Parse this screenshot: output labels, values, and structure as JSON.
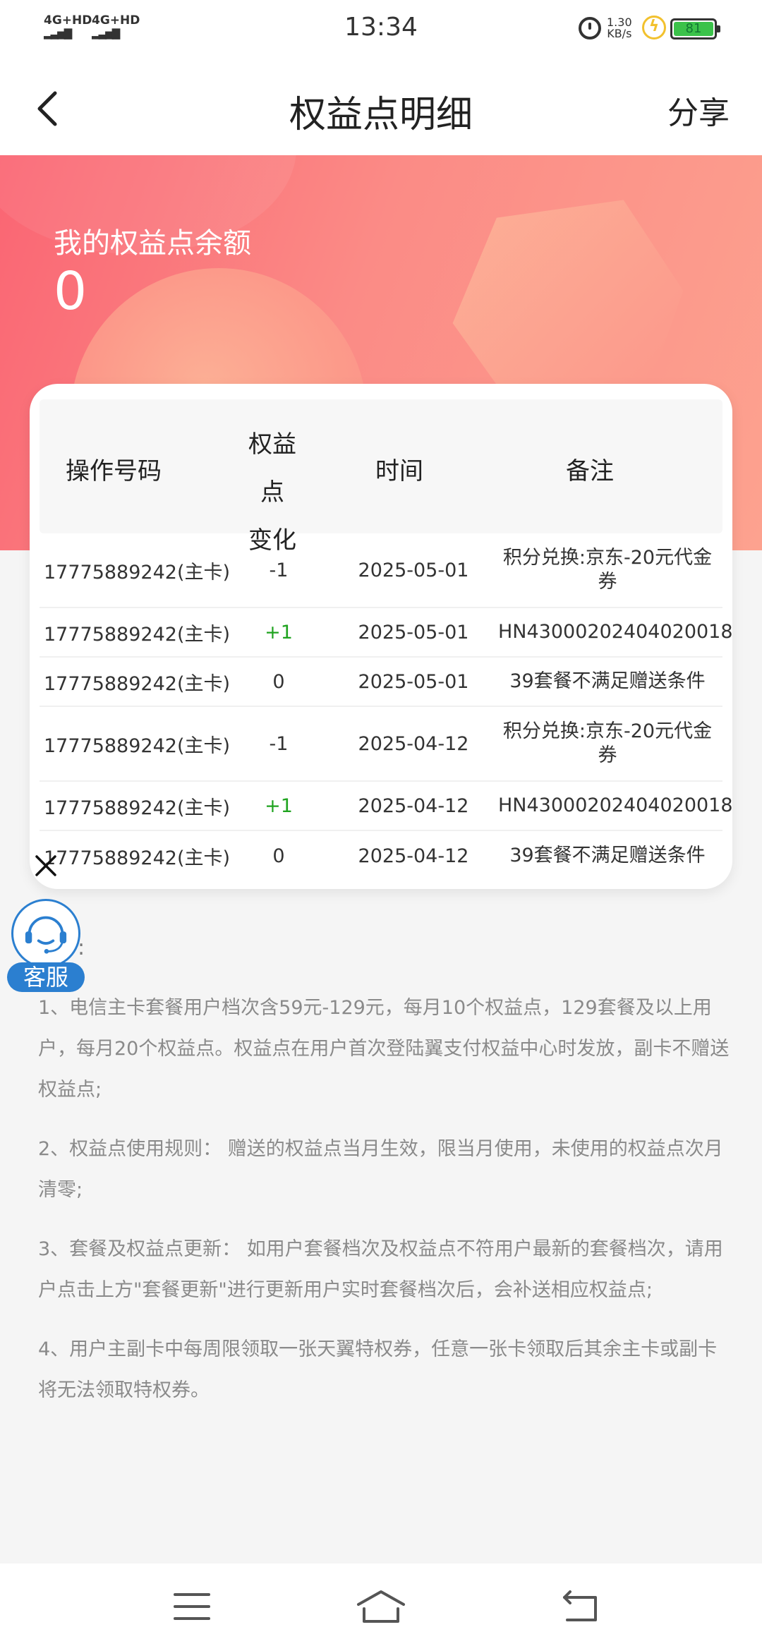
{
  "status_bar": {
    "signal_1": "4G+HD",
    "signal_2": "4G+HD",
    "time": "13:34",
    "speed_value": "1.30",
    "speed_unit": "KB/s",
    "battery": "81",
    "battery_color": "#3bc24a"
  },
  "nav": {
    "title": "权益点明细",
    "share_label": "分享",
    "back_icon": "chevron-left-icon"
  },
  "hero": {
    "balance_label": "我的权益点余额",
    "balance_value": "0",
    "gradient_start": "#fa6573",
    "gradient_end": "#fda28f"
  },
  "table": {
    "headers": {
      "operation_number": "操作号码",
      "points_change_line1": "权益点",
      "points_change_line2": "变化",
      "time": "时间",
      "note": "备注"
    },
    "rows": [
      {
        "number": "17775889242(主卡)",
        "change": "-1",
        "time": "2025-05-01",
        "note": "积分兑换:京东-20元代金券"
      },
      {
        "number": "17775889242(主卡)",
        "change": "+1",
        "time": "2025-05-01",
        "note": "HN43000202404020018"
      },
      {
        "number": "17775889242(主卡)",
        "change": "0",
        "time": "2025-05-01",
        "note": "39套餐不满足赠送条件"
      },
      {
        "number": "17775889242(主卡)",
        "change": "-1",
        "time": "2025-04-12",
        "note": "积分兑换:京东-20元代金券"
      },
      {
        "number": "17775889242(主卡)",
        "change": "+1",
        "time": "2025-04-12",
        "note": "HN43000202404020018"
      },
      {
        "number": "17775889242(主卡)",
        "change": "0",
        "time": "2025-04-12",
        "note": "39套餐不满足赠送条件"
      }
    ]
  },
  "customer_service": {
    "label": "客服",
    "color": "#2b7fd0"
  },
  "rules": {
    "colon": ":",
    "items": [
      "1、电信主卡套餐用户档次含59元-129元，每月10个权益点，129套餐及以上用户，每月20个权益点。权益点在用户首次登陆翼支付权益中心时发放，副卡不赠送权益点;",
      "2、权益点使用规则： 赠送的权益点当月生效，限当月使用，未使用的权益点次月清零;",
      "3、套餐及权益点更新： 如用户套餐档次及权益点不符用户最新的套餐档次，请用户点击上方\"套餐更新\"进行更新用户实时套餐档次后，会补送相应权益点;",
      "4、用户主副卡中每周限领取一张天翼特权券，任意一张卡领取后其余主卡或副卡将无法领取特权券。"
    ]
  },
  "system_nav": {
    "menu_icon": "menu-icon",
    "home_icon": "home-icon",
    "back_icon": "back-icon"
  }
}
